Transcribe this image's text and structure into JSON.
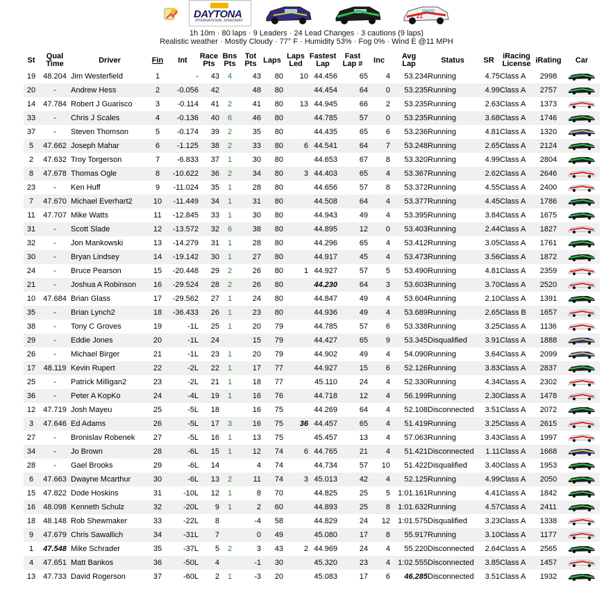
{
  "session": {
    "track_logo_text": "DAYTONA",
    "track_logo_sub": "INTERNATIONAL SPEEDWAY",
    "line1": "1h 10m · 80 laps · 9 Leaders · 24 Lead Changes · 3 cautions (9 laps)",
    "line2": "Realistic weather · Mostly Cloudy · 77° F · Humidity 53% · Fog 0% · Wind E @11 MPH"
  },
  "columns": {
    "st": "St",
    "qual1": "Qual",
    "qual2": "Time",
    "driver": "Driver",
    "fin": "Fin",
    "int": "Int",
    "race1": "Race",
    "race2": "Pts",
    "bns1": "Bns",
    "bns2": "Pts",
    "tot1": "Tot",
    "tot2": "Pts",
    "laps": "Laps",
    "led1": "Laps",
    "led2": "Led",
    "fastest1": "Fastest",
    "fastest2": "Lap",
    "fastnum1": "Fast",
    "fastnum2": "Lap #",
    "inc": "Inc",
    "avg1": "Avg",
    "avg2": "Lap",
    "status": "Status",
    "sr": "SR",
    "lic1": "iRacing",
    "lic2": "License",
    "irating": "iRating",
    "car": "Car"
  },
  "colors": {
    "bonus_green": "#1a8a1a",
    "row_alt": "#f0f0f0"
  },
  "rows": [
    {
      "st": "19",
      "qual": "48.204",
      "driver": "Jim Westerfield",
      "fin": "1",
      "int": "-",
      "race": "43",
      "bns": "4",
      "tot": "43",
      "laps": "80",
      "led": "10",
      "fastest": "44.456",
      "fastnum": "65",
      "inc": "4",
      "avg": "53.234",
      "status": "Running",
      "sr": "4.75",
      "lic": "Class A",
      "ir": "2998",
      "car": "green"
    },
    {
      "st": "20",
      "qual": "-",
      "driver": "Andrew Hess",
      "fin": "2",
      "int": "-0.056",
      "race": "42",
      "bns": "",
      "tot": "48",
      "laps": "80",
      "led": "",
      "fastest": "44.454",
      "fastnum": "64",
      "inc": "0",
      "avg": "53.235",
      "status": "Running",
      "sr": "4.99",
      "lic": "Class A",
      "ir": "2757",
      "car": "green"
    },
    {
      "st": "14",
      "qual": "47.784",
      "driver": "Robert J Guarisco",
      "fin": "3",
      "int": "-0.114",
      "race": "41",
      "bns": "2",
      "tot": "41",
      "laps": "80",
      "led": "13",
      "fastest": "44.945",
      "fastnum": "66",
      "inc": "2",
      "avg": "53.235",
      "status": "Running",
      "sr": "2.63",
      "lic": "Class A",
      "ir": "1373",
      "car": "red"
    },
    {
      "st": "33",
      "qual": "-",
      "driver": "Chris J Scales",
      "fin": "4",
      "int": "-0.136",
      "race": "40",
      "bns": "6",
      "tot": "46",
      "laps": "80",
      "led": "",
      "fastest": "44.785",
      "fastnum": "57",
      "inc": "0",
      "avg": "53.235",
      "status": "Running",
      "sr": "3.68",
      "lic": "Class A",
      "ir": "1746",
      "car": "green"
    },
    {
      "st": "37",
      "qual": "-",
      "driver": "Steven Thomson",
      "fin": "5",
      "int": "-0.174",
      "race": "39",
      "bns": "2",
      "tot": "35",
      "laps": "80",
      "led": "",
      "fastest": "44.435",
      "fastnum": "65",
      "inc": "6",
      "avg": "53.236",
      "status": "Running",
      "sr": "4.81",
      "lic": "Class A",
      "ir": "1320",
      "car": "purple"
    },
    {
      "st": "5",
      "qual": "47.662",
      "driver": "Joseph Mahar",
      "fin": "6",
      "int": "-1.125",
      "race": "38",
      "bns": "2",
      "tot": "33",
      "laps": "80",
      "led": "6",
      "fastest": "44.541",
      "fastnum": "64",
      "inc": "7",
      "avg": "53.248",
      "status": "Running",
      "sr": "2.65",
      "lic": "Class A",
      "ir": "2124",
      "car": "green"
    },
    {
      "st": "2",
      "qual": "47.632",
      "driver": "Troy Torgerson",
      "fin": "7",
      "int": "-6.833",
      "race": "37",
      "bns": "1",
      "tot": "30",
      "laps": "80",
      "led": "",
      "fastest": "44.653",
      "fastnum": "67",
      "inc": "8",
      "avg": "53.320",
      "status": "Running",
      "sr": "4.99",
      "lic": "Class A",
      "ir": "2804",
      "car": "green"
    },
    {
      "st": "8",
      "qual": "47.678",
      "driver": "Thomas Ogle",
      "fin": "8",
      "int": "-10.622",
      "race": "36",
      "bns": "2",
      "tot": "34",
      "laps": "80",
      "led": "3",
      "fastest": "44.403",
      "fastnum": "65",
      "inc": "4",
      "avg": "53.367",
      "status": "Running",
      "sr": "2.62",
      "lic": "Class A",
      "ir": "2646",
      "car": "red"
    },
    {
      "st": "23",
      "qual": "-",
      "driver": "Ken Huff",
      "fin": "9",
      "int": "-11.024",
      "race": "35",
      "bns": "1",
      "tot": "28",
      "laps": "80",
      "led": "",
      "fastest": "44.656",
      "fastnum": "57",
      "inc": "8",
      "avg": "53.372",
      "status": "Running",
      "sr": "4.55",
      "lic": "Class A",
      "ir": "2400",
      "car": "red"
    },
    {
      "st": "7",
      "qual": "47.670",
      "driver": "Michael Everhart2",
      "fin": "10",
      "int": "-11.449",
      "race": "34",
      "bns": "1",
      "tot": "31",
      "laps": "80",
      "led": "",
      "fastest": "44.508",
      "fastnum": "64",
      "inc": "4",
      "avg": "53.377",
      "status": "Running",
      "sr": "4.45",
      "lic": "Class A",
      "ir": "1786",
      "car": "green"
    },
    {
      "st": "11",
      "qual": "47.707",
      "driver": "Mike Watts",
      "fin": "11",
      "int": "-12.845",
      "race": "33",
      "bns": "1",
      "tot": "30",
      "laps": "80",
      "led": "",
      "fastest": "44.943",
      "fastnum": "49",
      "inc": "4",
      "avg": "53.395",
      "status": "Running",
      "sr": "3.84",
      "lic": "Class A",
      "ir": "1675",
      "car": "green"
    },
    {
      "st": "31",
      "qual": "-",
      "driver": "Scott Slade",
      "fin": "12",
      "int": "-13.572",
      "race": "32",
      "bns": "6",
      "tot": "38",
      "laps": "80",
      "led": "",
      "fastest": "44.895",
      "fastnum": "12",
      "inc": "0",
      "avg": "53.403",
      "status": "Running",
      "sr": "2.44",
      "lic": "Class A",
      "ir": "1827",
      "car": "red"
    },
    {
      "st": "32",
      "qual": "-",
      "driver": "Jon Mankowski",
      "fin": "13",
      "int": "-14.279",
      "race": "31",
      "bns": "1",
      "tot": "28",
      "laps": "80",
      "led": "",
      "fastest": "44.296",
      "fastnum": "65",
      "inc": "4",
      "avg": "53.412",
      "status": "Running",
      "sr": "3.05",
      "lic": "Class A",
      "ir": "1761",
      "car": "green"
    },
    {
      "st": "30",
      "qual": "-",
      "driver": "Bryan Lindsey",
      "fin": "14",
      "int": "-19.142",
      "race": "30",
      "bns": "1",
      "tot": "27",
      "laps": "80",
      "led": "",
      "fastest": "44.917",
      "fastnum": "45",
      "inc": "4",
      "avg": "53.473",
      "status": "Running",
      "sr": "3.56",
      "lic": "Class A",
      "ir": "1872",
      "car": "green"
    },
    {
      "st": "24",
      "qual": "-",
      "driver": "Bruce Pearson",
      "fin": "15",
      "int": "-20.448",
      "race": "29",
      "bns": "2",
      "tot": "26",
      "laps": "80",
      "led": "1",
      "fastest": "44.927",
      "fastnum": "57",
      "inc": "5",
      "avg": "53.490",
      "status": "Running",
      "sr": "4.81",
      "lic": "Class A",
      "ir": "2359",
      "car": "red"
    },
    {
      "st": "21",
      "qual": "-",
      "driver": "Joshua A Robinson",
      "fin": "16",
      "int": "-29.524",
      "race": "28",
      "bns": "2",
      "tot": "26",
      "laps": "80",
      "led": "",
      "fastest": "44.230",
      "fastest_hl": true,
      "fastnum": "64",
      "inc": "3",
      "avg": "53.603",
      "status": "Running",
      "sr": "3.70",
      "lic": "Class A",
      "ir": "2520",
      "car": "red"
    },
    {
      "st": "10",
      "qual": "47.684",
      "driver": "Brian Glass",
      "fin": "17",
      "int": "-29.562",
      "race": "27",
      "bns": "1",
      "tot": "24",
      "laps": "80",
      "led": "",
      "fastest": "44.847",
      "fastnum": "49",
      "inc": "4",
      "avg": "53.604",
      "status": "Running",
      "sr": "2.10",
      "lic": "Class A",
      "ir": "1391",
      "car": "green"
    },
    {
      "st": "35",
      "qual": "-",
      "driver": "Brian Lynch2",
      "fin": "18",
      "int": "-36.433",
      "race": "26",
      "bns": "1",
      "tot": "23",
      "laps": "80",
      "led": "",
      "fastest": "44.936",
      "fastnum": "49",
      "inc": "4",
      "avg": "53.689",
      "status": "Running",
      "sr": "2.65",
      "lic": "Class B",
      "ir": "1657",
      "car": "red"
    },
    {
      "st": "38",
      "qual": "-",
      "driver": "Tony C Groves",
      "fin": "19",
      "int": "-1L",
      "race": "25",
      "bns": "1",
      "tot": "20",
      "laps": "79",
      "led": "",
      "fastest": "44.785",
      "fastnum": "57",
      "inc": "6",
      "avg": "53.338",
      "status": "Running",
      "sr": "3.25",
      "lic": "Class A",
      "ir": "1136",
      "car": "red"
    },
    {
      "st": "29",
      "qual": "-",
      "driver": "Eddie Jones",
      "fin": "20",
      "int": "-1L",
      "race": "24",
      "bns": "",
      "tot": "15",
      "laps": "79",
      "led": "",
      "fastest": "44.427",
      "fastnum": "65",
      "inc": "9",
      "avg": "53.345",
      "status": "Disqualified",
      "sr": "3.91",
      "lic": "Class A",
      "ir": "1888",
      "car": "purple"
    },
    {
      "st": "26",
      "qual": "-",
      "driver": "Michael Birger",
      "fin": "21",
      "int": "-1L",
      "race": "23",
      "bns": "1",
      "tot": "20",
      "laps": "79",
      "led": "",
      "fastest": "44.902",
      "fastnum": "49",
      "inc": "4",
      "avg": "54.090",
      "status": "Running",
      "sr": "3.64",
      "lic": "Class A",
      "ir": "2099",
      "car": "purple"
    },
    {
      "st": "17",
      "qual": "48.119",
      "driver": "Kevin Rupert",
      "fin": "22",
      "int": "-2L",
      "race": "22",
      "bns": "1",
      "tot": "17",
      "laps": "77",
      "led": "",
      "fastest": "44.927",
      "fastnum": "15",
      "inc": "6",
      "avg": "52.126",
      "status": "Running",
      "sr": "3.83",
      "lic": "Class A",
      "ir": "2837",
      "car": "green"
    },
    {
      "st": "25",
      "qual": "-",
      "driver": "Patrick Milligan2",
      "fin": "23",
      "int": "-2L",
      "race": "21",
      "bns": "1",
      "tot": "18",
      "laps": "77",
      "led": "",
      "fastest": "45.110",
      "fastnum": "24",
      "inc": "4",
      "avg": "52.330",
      "status": "Running",
      "sr": "4.34",
      "lic": "Class A",
      "ir": "2302",
      "car": "red"
    },
    {
      "st": "36",
      "qual": "-",
      "driver": "Peter A KopKo",
      "fin": "24",
      "int": "-4L",
      "race": "19",
      "bns": "1",
      "tot": "16",
      "laps": "76",
      "led": "",
      "fastest": "44.718",
      "fastnum": "12",
      "inc": "4",
      "avg": "56.199",
      "status": "Running",
      "sr": "2.30",
      "lic": "Class A",
      "ir": "1478",
      "car": "red"
    },
    {
      "st": "12",
      "qual": "47.719",
      "driver": "Josh Mayeu",
      "fin": "25",
      "int": "-5L",
      "race": "18",
      "bns": "",
      "tot": "16",
      "laps": "75",
      "led": "",
      "fastest": "44.269",
      "fastnum": "64",
      "inc": "4",
      "avg": "52.108",
      "status": "Disconnected",
      "sr": "3.51",
      "lic": "Class A",
      "ir": "2072",
      "car": "green"
    },
    {
      "st": "3",
      "qual": "47.646",
      "driver": "Ed Adams",
      "fin": "26",
      "int": "-5L",
      "race": "17",
      "bns": "3",
      "tot": "16",
      "laps": "75",
      "led": "36",
      "led_hl": true,
      "fastest": "44.457",
      "fastnum": "65",
      "inc": "4",
      "avg": "51.419",
      "status": "Running",
      "sr": "3.25",
      "lic": "Class A",
      "ir": "2615",
      "car": "red"
    },
    {
      "st": "27",
      "qual": "-",
      "driver": "Bronislav Robenek",
      "fin": "27",
      "int": "-5L",
      "race": "16",
      "bns": "1",
      "tot": "13",
      "laps": "75",
      "led": "",
      "fastest": "45.457",
      "fastnum": "13",
      "inc": "4",
      "avg": "57.063",
      "status": "Running",
      "sr": "3.43",
      "lic": "Class A",
      "ir": "1997",
      "car": "red"
    },
    {
      "st": "34",
      "qual": "-",
      "driver": "Jo Brown",
      "fin": "28",
      "int": "-6L",
      "race": "15",
      "bns": "1",
      "tot": "12",
      "laps": "74",
      "led": "6",
      "fastest": "44.765",
      "fastnum": "21",
      "inc": "4",
      "avg": "51.421",
      "status": "Disconnected",
      "sr": "1.11",
      "lic": "Class A",
      "ir": "1668",
      "car": "purple"
    },
    {
      "st": "28",
      "qual": "-",
      "driver": "Gael Brooks",
      "fin": "29",
      "int": "-6L",
      "race": "14",
      "bns": "",
      "tot": "4",
      "laps": "74",
      "led": "",
      "fastest": "44.734",
      "fastnum": "57",
      "inc": "10",
      "avg": "51.422",
      "status": "Disqualified",
      "sr": "3.40",
      "lic": "Class A",
      "ir": "1953",
      "car": "green"
    },
    {
      "st": "6",
      "qual": "47.663",
      "driver": "Dwayne Mcarthur",
      "fin": "30",
      "int": "-6L",
      "race": "13",
      "bns": "2",
      "tot": "11",
      "laps": "74",
      "led": "3",
      "fastest": "45.013",
      "fastnum": "42",
      "inc": "4",
      "avg": "52.125",
      "status": "Running",
      "sr": "4.99",
      "lic": "Class A",
      "ir": "2050",
      "car": "green"
    },
    {
      "st": "15",
      "qual": "47.822",
      "driver": "Dode Hoskins",
      "fin": "31",
      "int": "-10L",
      "race": "12",
      "bns": "1",
      "tot": "8",
      "laps": "70",
      "led": "",
      "fastest": "44.825",
      "fastnum": "25",
      "inc": "5",
      "avg": "1:01.161",
      "status": "Running",
      "sr": "4.41",
      "lic": "Class A",
      "ir": "1842",
      "car": "green"
    },
    {
      "st": "16",
      "qual": "48.098",
      "driver": "Kenneth Schulz",
      "fin": "32",
      "int": "-20L",
      "race": "9",
      "bns": "1",
      "tot": "2",
      "laps": "60",
      "led": "",
      "fastest": "44.893",
      "fastnum": "25",
      "inc": "8",
      "avg": "1:01.632",
      "status": "Running",
      "sr": "4.57",
      "lic": "Class A",
      "ir": "2411",
      "car": "green"
    },
    {
      "st": "18",
      "qual": "48.148",
      "driver": "Rob Shewmaker",
      "fin": "33",
      "int": "-22L",
      "race": "8",
      "bns": "",
      "tot": "-4",
      "laps": "58",
      "led": "",
      "fastest": "44.829",
      "fastnum": "24",
      "inc": "12",
      "avg": "1:01.575",
      "status": "Disqualified",
      "sr": "3.23",
      "lic": "Class A",
      "ir": "1338",
      "car": "red"
    },
    {
      "st": "9",
      "qual": "47.679",
      "driver": "Chris Sawallich",
      "fin": "34",
      "int": "-31L",
      "race": "7",
      "bns": "",
      "tot": "0",
      "laps": "49",
      "led": "",
      "fastest": "45.080",
      "fastnum": "17",
      "inc": "8",
      "avg": "55.917",
      "status": "Running",
      "sr": "3.10",
      "lic": "Class A",
      "ir": "1177",
      "car": "red"
    },
    {
      "st": "1",
      "qual": "47.548",
      "qual_hl": true,
      "driver": "Mike Schrader",
      "fin": "35",
      "int": "-37L",
      "race": "5",
      "bns": "2",
      "tot": "3",
      "laps": "43",
      "led": "2",
      "fastest": "44.969",
      "fastnum": "24",
      "inc": "4",
      "avg": "55.220",
      "status": "Disconnected",
      "sr": "2.64",
      "lic": "Class A",
      "ir": "2565",
      "car": "green"
    },
    {
      "st": "4",
      "qual": "47.651",
      "driver": "Matt Bankos",
      "fin": "36",
      "int": "-50L",
      "race": "4",
      "bns": "",
      "tot": "-1",
      "laps": "30",
      "led": "",
      "fastest": "45.320",
      "fastnum": "23",
      "inc": "4",
      "avg": "1:02.555",
      "status": "Disconnected",
      "sr": "3.85",
      "lic": "Class A",
      "ir": "1457",
      "car": "red"
    },
    {
      "st": "13",
      "qual": "47.733",
      "driver": "David Rogerson",
      "fin": "37",
      "int": "-60L",
      "race": "2",
      "bns": "1",
      "tot": "-3",
      "laps": "20",
      "led": "",
      "fastest": "45.083",
      "fastnum": "17",
      "inc": "6",
      "avg": "46.285",
      "avg_hl": true,
      "status": "Disconnected",
      "sr": "3.51",
      "lic": "Class A",
      "ir": "1932",
      "car": "green"
    }
  ]
}
